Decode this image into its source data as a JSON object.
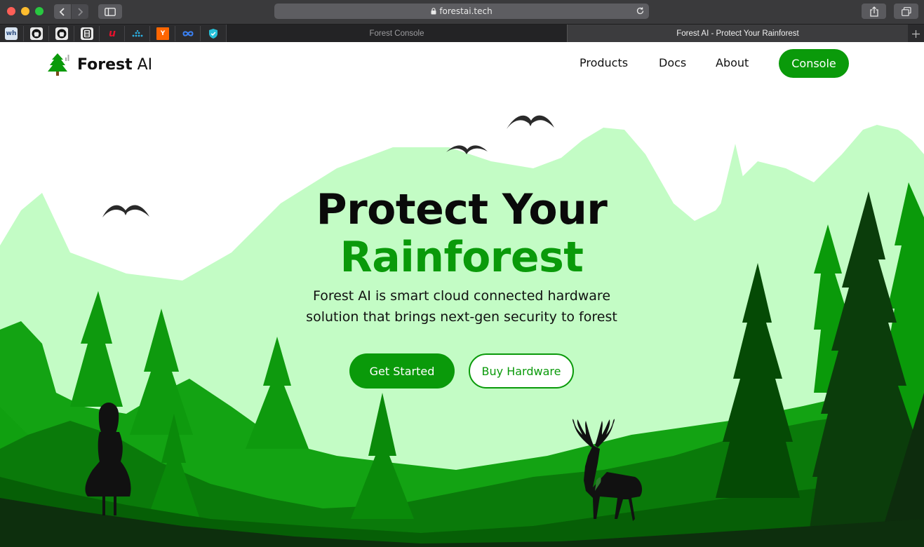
{
  "browser": {
    "url": "forestai.tech",
    "tabs": [
      {
        "title": "Forest Console",
        "active": false
      },
      {
        "title": "Forest AI - Protect Your Rainforest",
        "active": true
      }
    ],
    "favorites": [
      {
        "icon": "wh-icon",
        "label": "wh"
      },
      {
        "icon": "github-icon"
      },
      {
        "icon": "github-icon"
      },
      {
        "icon": "doc-icon"
      },
      {
        "icon": "u-icon",
        "label": "u"
      },
      {
        "icon": "dots-icon"
      },
      {
        "icon": "ycombinator-icon",
        "label": "Y"
      },
      {
        "icon": "infinity-icon"
      },
      {
        "icon": "shield-icon"
      }
    ]
  },
  "site": {
    "logo": {
      "brand": "Forest",
      "suffix": " AI"
    },
    "nav": {
      "products": "Products",
      "docs": "Docs",
      "about": "About",
      "console": "Console"
    },
    "hero": {
      "title_line1": "Protect Your",
      "title_line2": "Rainforest",
      "subtitle_line1": "Forest AI is smart cloud connected hardware",
      "subtitle_line2": "solution that brings next-gen security to forest",
      "primary_cta": "Get Started",
      "secondary_cta": "Buy Hardware"
    }
  },
  "colors": {
    "brand_green": "#0a9a0a",
    "mint": "#c3fcc5",
    "mid_green": "#13a313",
    "deep_green": "#0a7a0a",
    "dark_green": "#054f05",
    "darkest_green": "#0f2f0f",
    "chrome_dark": "#3a3a3c"
  }
}
